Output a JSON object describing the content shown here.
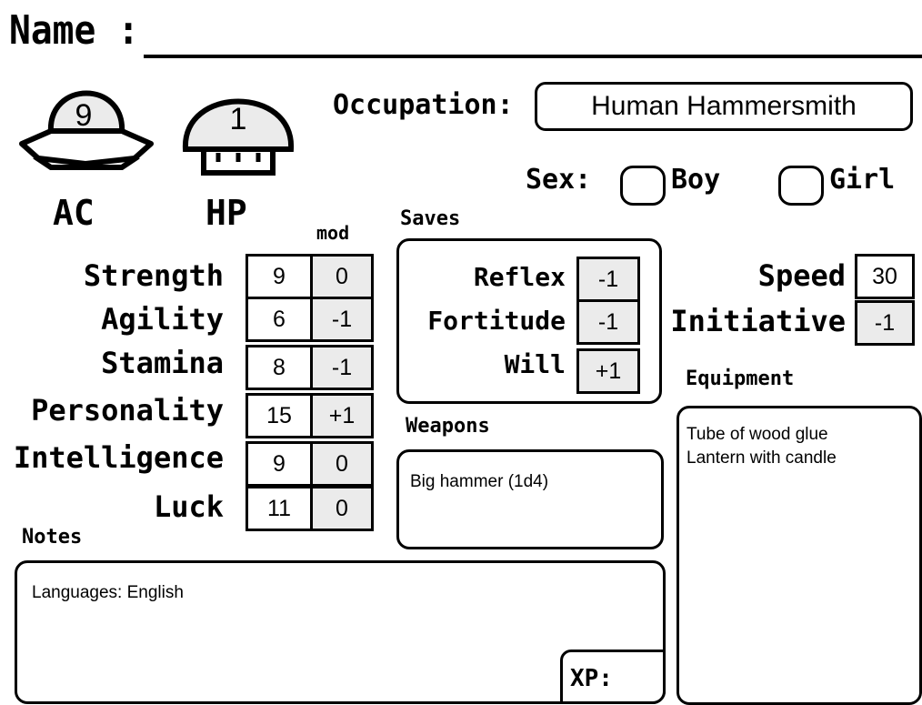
{
  "header": {
    "name_label": "Name :",
    "name_value": ""
  },
  "occupation": {
    "label": "Occupation:",
    "value": "Human Hammersmith"
  },
  "sex": {
    "label": "Sex:",
    "options": [
      {
        "label": "Boy",
        "checked": false
      },
      {
        "label": "Girl",
        "checked": false
      }
    ]
  },
  "ac": {
    "label": "AC",
    "value": "9",
    "icon": "shell-icon"
  },
  "hp": {
    "label": "HP",
    "value": "1",
    "icon": "mushroom-icon"
  },
  "stats": {
    "mod_header": "mod",
    "rows": [
      {
        "name": "Strength",
        "score": "9",
        "mod": "0"
      },
      {
        "name": "Agility",
        "score": "6",
        "mod": "-1"
      },
      {
        "name": "Stamina",
        "score": "8",
        "mod": "-1"
      },
      {
        "name": "Personality",
        "score": "15",
        "mod": "+1"
      },
      {
        "name": "Intelligence",
        "score": "9",
        "mod": "0"
      },
      {
        "name": "Luck",
        "score": "11",
        "mod": "0"
      }
    ]
  },
  "saves": {
    "label": "Saves",
    "rows": [
      {
        "name": "Reflex",
        "value": "-1"
      },
      {
        "name": "Fortitude",
        "value": "-1"
      },
      {
        "name": "Will",
        "value": "+1"
      }
    ]
  },
  "speed": {
    "label": "Speed",
    "value": "30"
  },
  "initiative": {
    "label": "Initiative",
    "value": "-1"
  },
  "weapons": {
    "label": "Weapons",
    "text": "Big hammer (1d4)"
  },
  "equipment": {
    "label": "Equipment",
    "lines": [
      "Tube of wood glue",
      "Lantern with candle"
    ]
  },
  "notes": {
    "label": "Notes",
    "text": "Languages: English"
  },
  "xp": {
    "label": "XP:",
    "value": ""
  },
  "colors": {
    "mod_fill": "#ebebeb",
    "shape_fill": "#ebebeb",
    "ink": "#000000"
  }
}
